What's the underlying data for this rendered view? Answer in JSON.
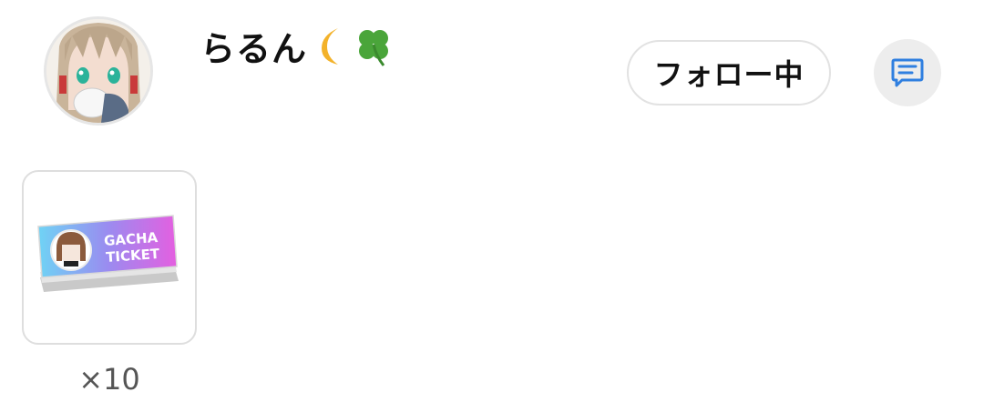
{
  "profile": {
    "username": "らるん",
    "username_emojis": [
      "moon-emoji",
      "four-leaf-clover-emoji"
    ]
  },
  "actions": {
    "follow_label": "フォロー中",
    "message_icon": "message-icon"
  },
  "items": [
    {
      "icon": "gacha-ticket-icon",
      "ticket_text_line1": "GACHA",
      "ticket_text_line2": "TICKET",
      "count": "×10"
    }
  ],
  "colors": {
    "accent_blue": "#2f7fe0",
    "button_border": "#e2e2e2",
    "icon_button_bg": "#ededed"
  }
}
